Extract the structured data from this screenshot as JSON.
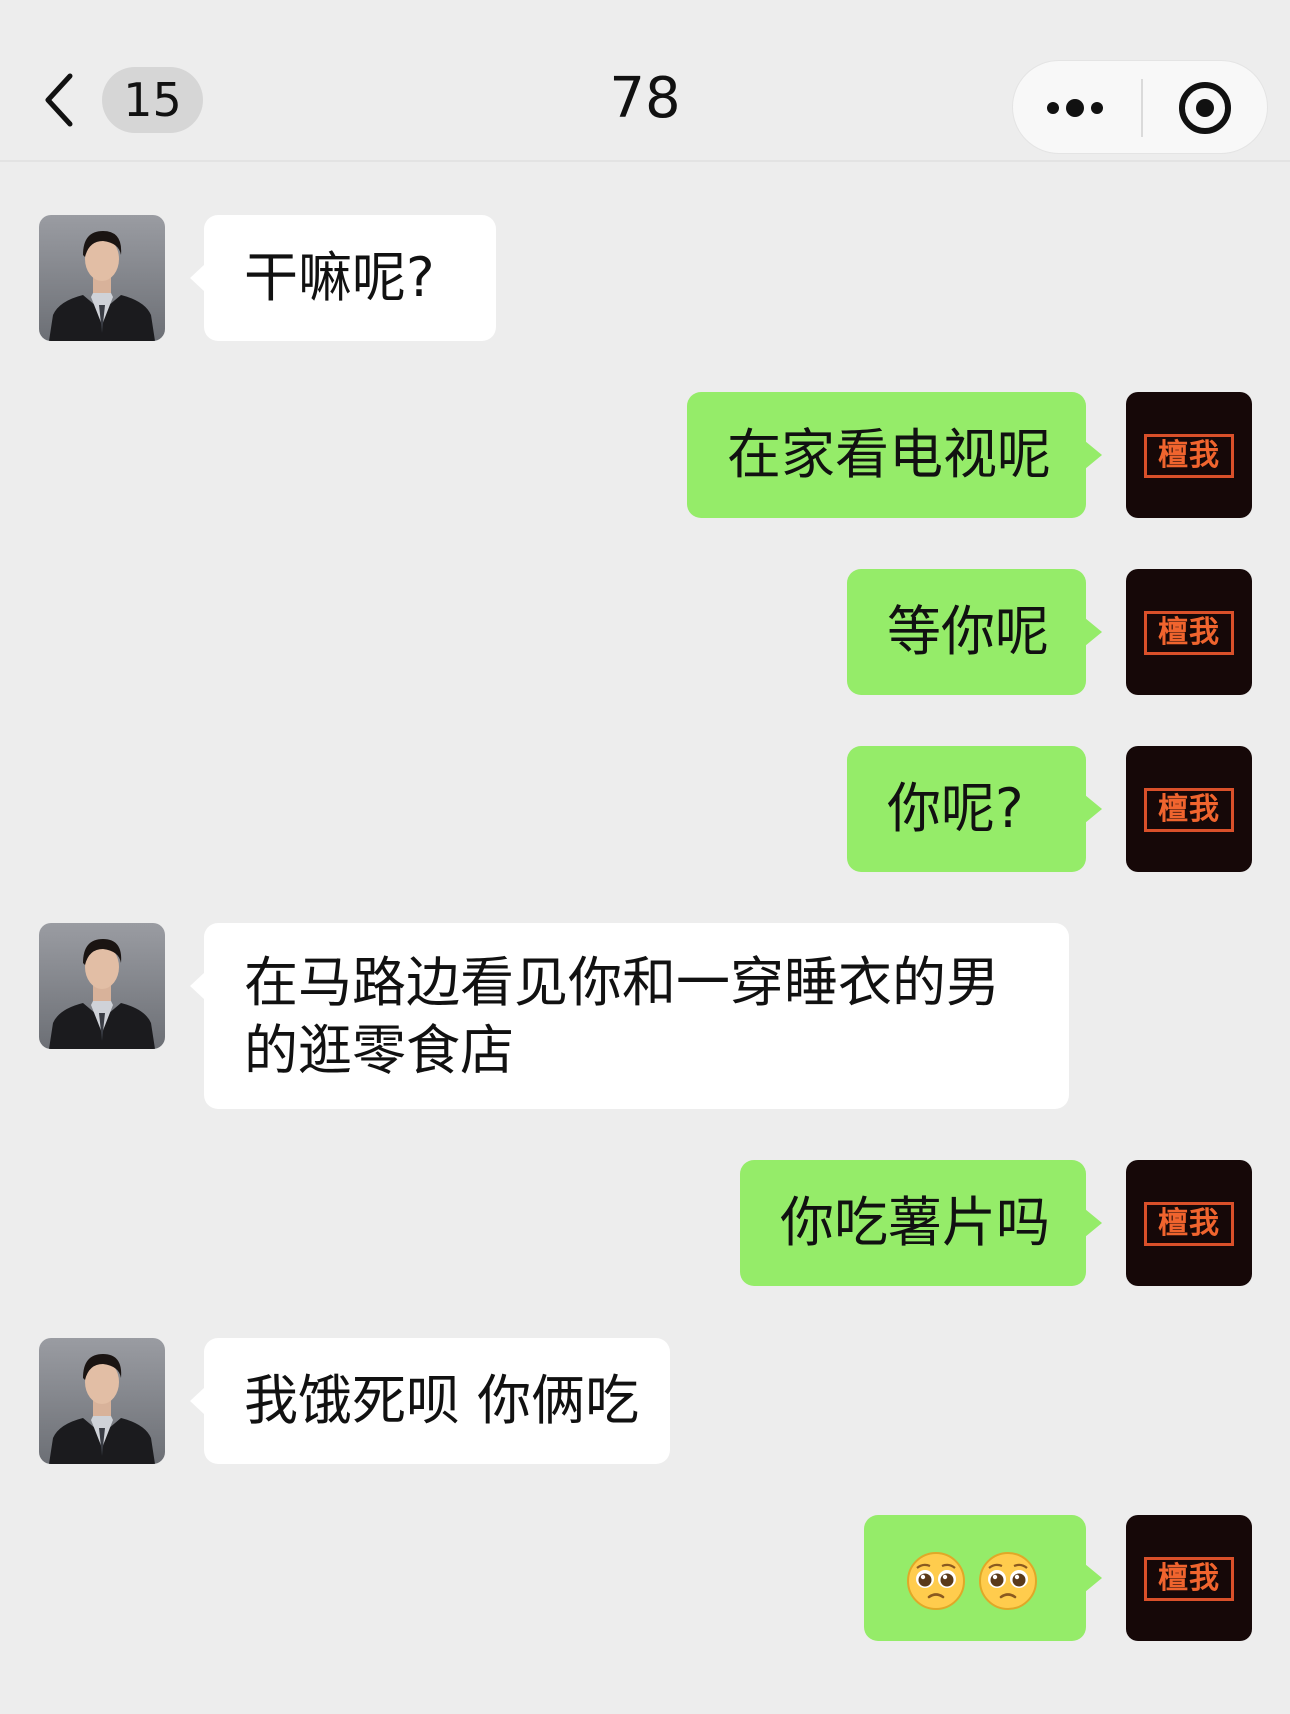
{
  "header": {
    "unread_count": "15",
    "title": "78"
  },
  "contact_avatar_icon": "man-in-suit-photo",
  "self_avatar": {
    "stamp_text": "檀我"
  },
  "messages": [
    {
      "side": "left",
      "text": "干嘛呢?"
    },
    {
      "side": "right",
      "text": "在家看电视呢"
    },
    {
      "side": "right",
      "text": "等你呢"
    },
    {
      "side": "right",
      "text": "你呢?"
    },
    {
      "side": "left",
      "text": "在马路边看见你和一穿睡衣的男的逛零食店"
    },
    {
      "side": "right",
      "text": "你吃薯片吗"
    },
    {
      "side": "left",
      "text": "我饿死呗 你俩吃"
    },
    {
      "side": "right",
      "text": "",
      "emojis": [
        "pleading-face",
        "pleading-face"
      ]
    }
  ],
  "colors": {
    "background": "#ededed",
    "bubble_self": "#95ec69",
    "bubble_other": "#ffffff",
    "stamp": "#f0642e"
  }
}
